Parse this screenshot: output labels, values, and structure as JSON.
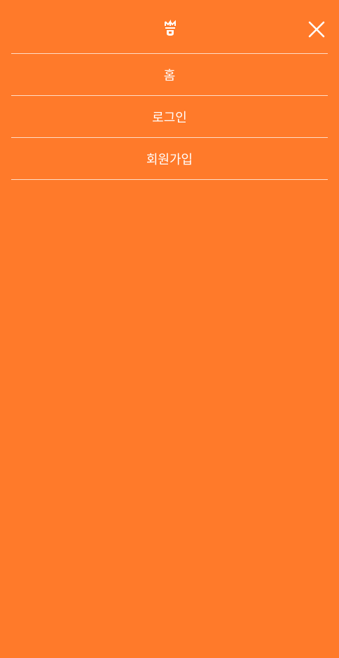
{
  "header": {
    "logo_icon": "brand-logo-icon",
    "close_icon": "close-icon"
  },
  "menu": {
    "items": [
      {
        "label": "홈"
      },
      {
        "label": "로그인"
      },
      {
        "label": "회원가입"
      }
    ]
  },
  "colors": {
    "background": "#ff7a2a",
    "text": "#ffffff",
    "divider": "#ffd0b0"
  }
}
